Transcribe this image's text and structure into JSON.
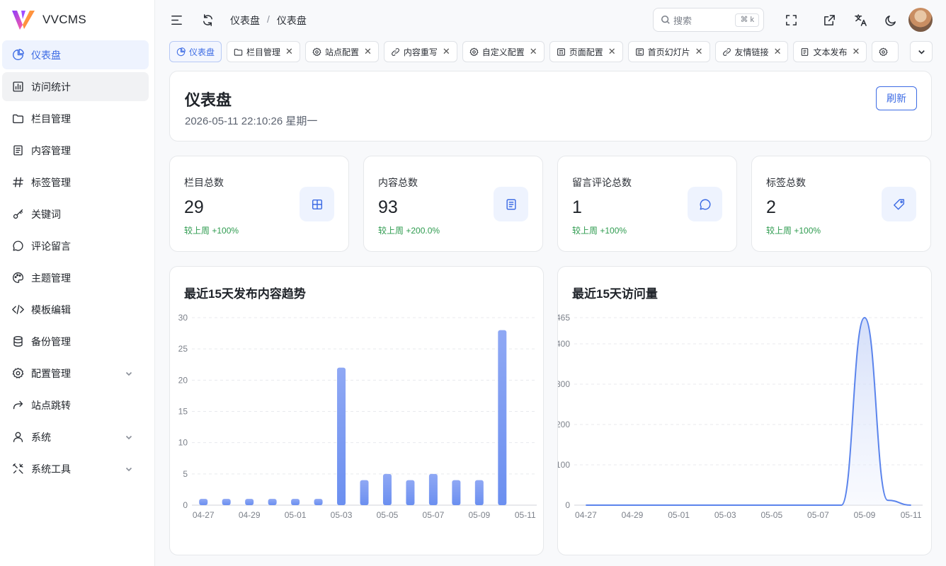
{
  "app": {
    "name": "VVCMS"
  },
  "sidebar": {
    "items": [
      {
        "label": "仪表盘",
        "icon": "pie-chart-icon",
        "active": true
      },
      {
        "label": "访问统计",
        "icon": "bar-chart-icon"
      },
      {
        "label": "栏目管理",
        "icon": "folder-icon"
      },
      {
        "label": "内容管理",
        "icon": "document-icon"
      },
      {
        "label": "标签管理",
        "icon": "hash-icon"
      },
      {
        "label": "关键词",
        "icon": "key-icon"
      },
      {
        "label": "评论留言",
        "icon": "message-icon"
      },
      {
        "label": "主题管理",
        "icon": "palette-icon"
      },
      {
        "label": "模板编辑",
        "icon": "code-icon"
      },
      {
        "label": "备份管理",
        "icon": "database-icon"
      },
      {
        "label": "配置管理",
        "icon": "settings-icon",
        "expandable": true
      },
      {
        "label": "站点跳转",
        "icon": "redirect-icon"
      },
      {
        "label": "系统",
        "icon": "user-icon",
        "expandable": true
      },
      {
        "label": "系统工具",
        "icon": "tools-icon",
        "expandable": true
      }
    ]
  },
  "header": {
    "breadcrumb": [
      "仪表盘",
      "仪表盘"
    ],
    "search_placeholder": "搜索",
    "search_shortcut": "⌘ k"
  },
  "tabs": [
    {
      "label": "仪表盘",
      "icon": "pie-chart-icon",
      "active": true,
      "closable": false
    },
    {
      "label": "栏目管理",
      "icon": "folder-icon",
      "closable": true
    },
    {
      "label": "站点配置",
      "icon": "settings-icon",
      "closable": true
    },
    {
      "label": "内容重写",
      "icon": "link-icon",
      "closable": true
    },
    {
      "label": "自定义配置",
      "icon": "settings-icon",
      "closable": true
    },
    {
      "label": "页面配置",
      "icon": "page-icon",
      "closable": true
    },
    {
      "label": "首页幻灯片",
      "icon": "slides-icon",
      "closable": true
    },
    {
      "label": "友情链接",
      "icon": "link-icon",
      "closable": true
    },
    {
      "label": "文本发布",
      "icon": "document-icon",
      "closable": true
    },
    {
      "label": "",
      "icon": "settings-icon",
      "closable": false
    }
  ],
  "page": {
    "title": "仪表盘",
    "datetime": "2026-05-11 22:10:26 星期一",
    "refresh_label": "刷新"
  },
  "stats": [
    {
      "label": "栏目总数",
      "value": "29",
      "trend": "较上周 +100%",
      "icon": "grid-icon"
    },
    {
      "label": "内容总数",
      "value": "93",
      "trend": "较上周 +200.0%",
      "icon": "document-icon"
    },
    {
      "label": "留言评论总数",
      "value": "1",
      "trend": "较上周 +100%",
      "icon": "message-icon"
    },
    {
      "label": "标签总数",
      "value": "2",
      "trend": "较上周 +100%",
      "icon": "tag-icon"
    }
  ],
  "colors": {
    "accent": "#3c6be4",
    "trend_up": "#2e9b4f",
    "bar": "#6b8ff0",
    "line": "#5b84ec"
  },
  "chart_data": [
    {
      "type": "bar",
      "title": "最近15天发布内容趋势",
      "categories": [
        "04-27",
        "04-28",
        "04-29",
        "04-30",
        "05-01",
        "05-02",
        "05-03",
        "05-04",
        "05-05",
        "05-06",
        "05-07",
        "05-08",
        "05-09",
        "05-10",
        "05-11"
      ],
      "tick_labels": [
        "04-27",
        "04-29",
        "05-01",
        "05-03",
        "05-05",
        "05-07",
        "05-09",
        "05-11"
      ],
      "values": [
        1,
        1,
        1,
        1,
        1,
        1,
        22,
        4,
        5,
        4,
        5,
        4,
        4,
        28,
        0
      ],
      "ylim": [
        0,
        30
      ],
      "yticks": [
        0,
        5,
        10,
        15,
        20,
        25,
        30
      ],
      "grid": true
    },
    {
      "type": "area",
      "title": "最近15天访问量",
      "categories": [
        "04-27",
        "04-28",
        "04-29",
        "04-30",
        "05-01",
        "05-02",
        "05-03",
        "05-04",
        "05-05",
        "05-06",
        "05-07",
        "05-08",
        "05-09",
        "05-10",
        "05-11"
      ],
      "tick_labels": [
        "04-27",
        "04-29",
        "05-01",
        "05-03",
        "05-05",
        "05-07",
        "05-09",
        "05-11"
      ],
      "values": [
        0,
        0,
        0,
        0,
        0,
        0,
        0,
        0,
        0,
        0,
        0,
        0,
        465,
        12,
        0
      ],
      "ylim": [
        0,
        465
      ],
      "yticks": [
        0,
        100,
        200,
        300,
        400,
        465
      ],
      "grid": true
    }
  ]
}
